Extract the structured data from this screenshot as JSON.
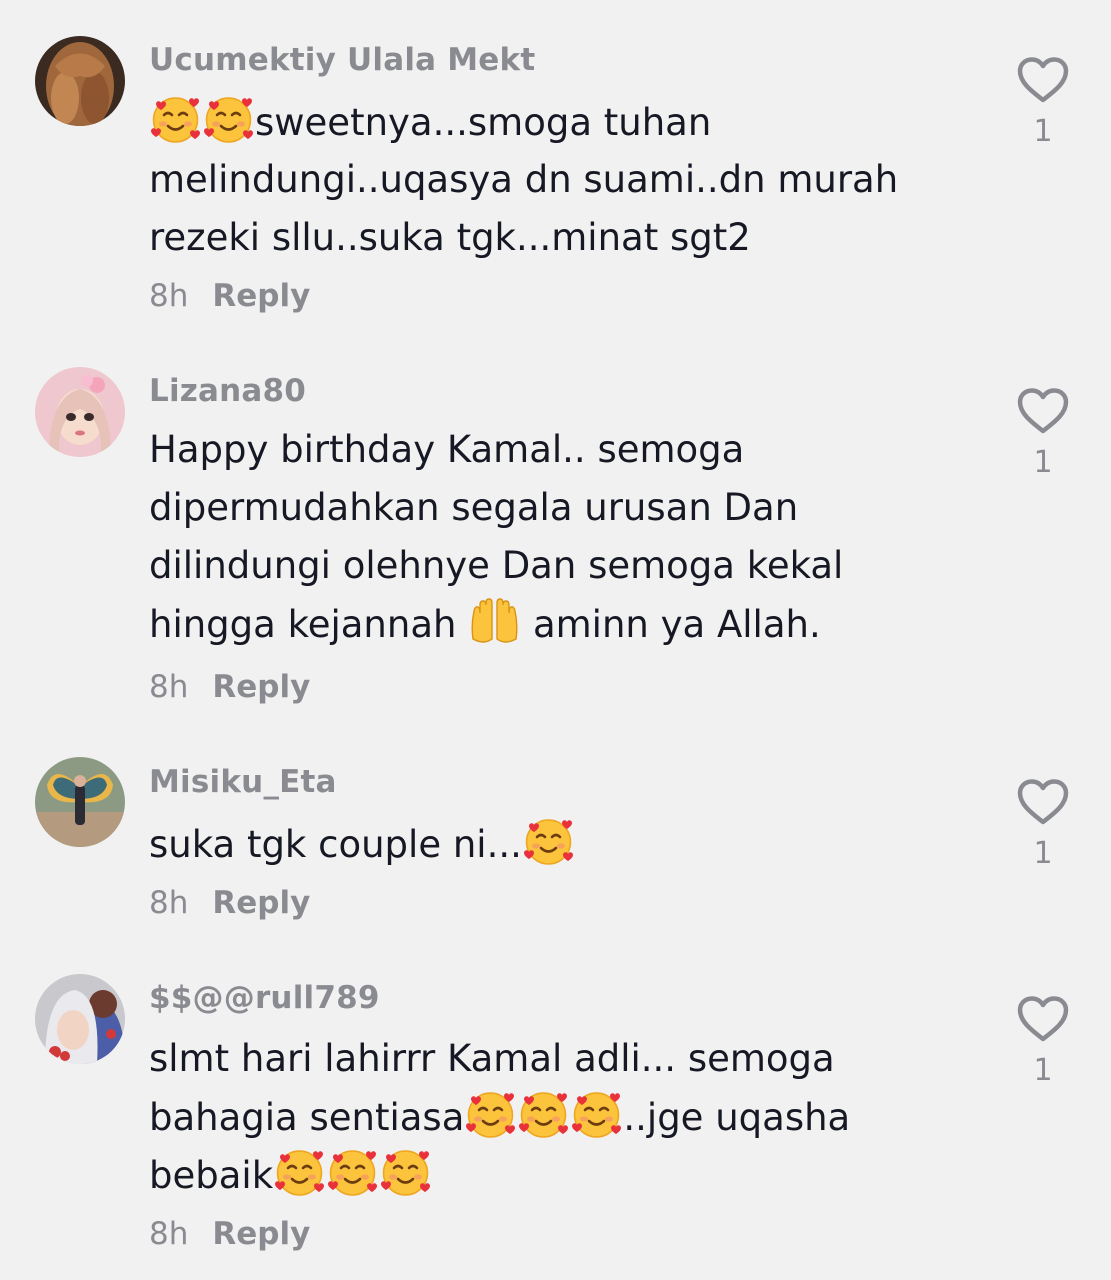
{
  "comments": [
    {
      "username": "Ucumektiy Ulala Mekt",
      "lines": [
        [
          "face-hearts-emoji",
          "face-hearts-emoji",
          "sweetnya...smoga tuhan"
        ],
        [
          "melindungi..uqasya dn suami..dn murah"
        ],
        [
          "rezeki sllu..suka tgk...minat sgt2"
        ]
      ],
      "time": "8h",
      "reply_label": "Reply",
      "like_count": "1"
    },
    {
      "username": "Lizana80",
      "lines": [
        [
          "Happy birthday Kamal.. semoga"
        ],
        [
          "dipermudahkan segala urusan Dan"
        ],
        [
          "dilindungi olehnye Dan semoga kekal"
        ],
        [
          "hingga kejannah ",
          "palms-up-emoji",
          " aminn ya Allah."
        ]
      ],
      "time": "8h",
      "reply_label": "Reply",
      "like_count": "1"
    },
    {
      "username": "Misiku_Eta",
      "lines": [
        [
          "suka tgk couple ni...",
          "face-hearts-emoji"
        ]
      ],
      "time": "8h",
      "reply_label": "Reply",
      "like_count": "1"
    },
    {
      "username": "$$@@rull789",
      "lines": [
        [
          "slmt hari lahirrr Kamal adli... semoga"
        ],
        [
          "bahagia sentiasa",
          "face-hearts-emoji",
          "face-hearts-emoji",
          "face-hearts-emoji",
          "..jge uqasha"
        ],
        [
          "bebaik",
          "face-hearts-emoji",
          "face-hearts-emoji",
          "face-hearts-emoji"
        ]
      ],
      "time": "8h",
      "reply_label": "Reply",
      "like_count": "1"
    }
  ],
  "colors": {
    "background": "#f1f1f2",
    "text": "#161823",
    "secondary_text": "#8a8b91"
  }
}
